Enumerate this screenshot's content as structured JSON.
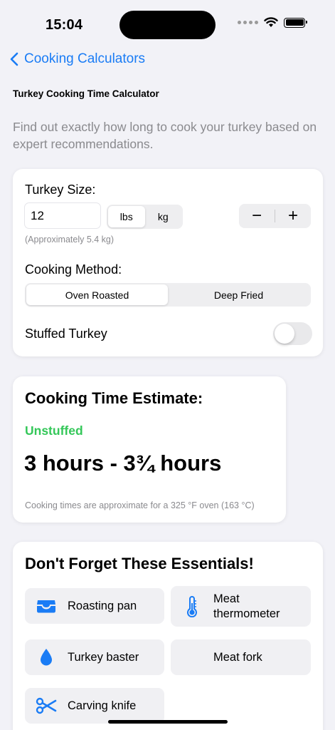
{
  "status_bar": {
    "time": "15:04"
  },
  "nav": {
    "back_label": "Cooking Calculators"
  },
  "page_title": "Turkey Cooking Time Calculator",
  "intro": "Find out exactly how long to cook your turkey based on expert recommendations.",
  "input_card": {
    "size_label": "Turkey Size:",
    "size_value": "12",
    "units": [
      {
        "label": "lbs",
        "selected": true
      },
      {
        "label": "kg",
        "selected": false
      }
    ],
    "stepper": {
      "minus": "−",
      "plus": "+"
    },
    "approx_note": "(Approximately 5.4 kg)",
    "method_label": "Cooking Method:",
    "methods": [
      {
        "label": "Oven Roasted",
        "selected": true
      },
      {
        "label": "Deep Fried",
        "selected": false
      }
    ],
    "stuffed_label": "Stuffed Turkey",
    "stuffed_on": false
  },
  "estimate": {
    "title": "Cooking Time Estimate:",
    "status": "Unstuffed",
    "value": "3 hours - 3¾ hours",
    "note": "Cooking times are approximate for a 325 °F oven (163 °C)"
  },
  "essentials": {
    "title": "Don't Forget These Essentials!",
    "items": [
      {
        "label": "Roasting pan",
        "icon": "tray-icon"
      },
      {
        "label": "Meat thermometer",
        "icon": "thermometer-icon"
      },
      {
        "label": "Turkey baster",
        "icon": "drop-icon"
      },
      {
        "label": "Meat fork",
        "icon": ""
      },
      {
        "label": "Carving knife",
        "icon": "scissors-icon"
      }
    ]
  },
  "colors": {
    "accent": "#1a7cf5",
    "success": "#34c759",
    "background": "#f2f2f7"
  }
}
